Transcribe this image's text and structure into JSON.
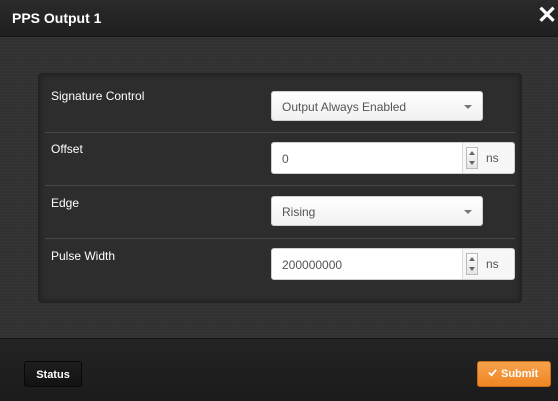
{
  "dialog": {
    "title": "PPS Output 1",
    "close_icon": "close-icon"
  },
  "fields": {
    "signature_control": {
      "label": "Signature Control",
      "value": "Output Always Enabled"
    },
    "offset": {
      "label": "Offset",
      "value": "0",
      "unit": "ns"
    },
    "edge": {
      "label": "Edge",
      "value": "Rising"
    },
    "pulse_width": {
      "label": "Pulse Width",
      "value": "200000000",
      "unit": "ns"
    }
  },
  "footer": {
    "status_label": "Status",
    "submit_label": "Submit",
    "submit_icon": "check-icon"
  },
  "colors": {
    "accent": "#f28a2a",
    "titlebar": "#232323",
    "dialog_bg": "#323232"
  }
}
